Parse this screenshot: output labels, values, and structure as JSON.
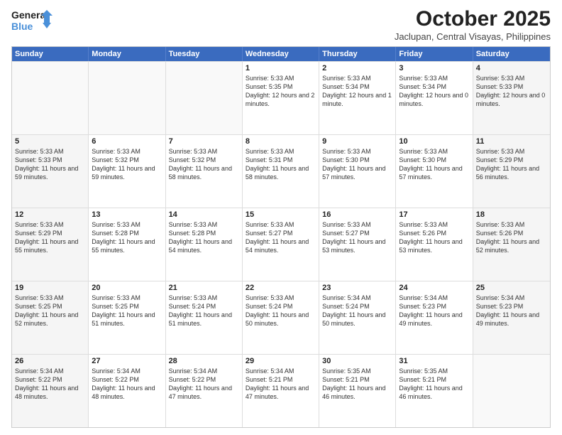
{
  "logo": {
    "line1": "General",
    "line2": "Blue"
  },
  "title": "October 2025",
  "subtitle": "Jaclupan, Central Visayas, Philippines",
  "header": {
    "days": [
      "Sunday",
      "Monday",
      "Tuesday",
      "Wednesday",
      "Thursday",
      "Friday",
      "Saturday"
    ]
  },
  "weeks": [
    [
      {
        "day": "",
        "sunrise": "",
        "sunset": "",
        "daylight": ""
      },
      {
        "day": "",
        "sunrise": "",
        "sunset": "",
        "daylight": ""
      },
      {
        "day": "",
        "sunrise": "",
        "sunset": "",
        "daylight": ""
      },
      {
        "day": "1",
        "sunrise": "Sunrise: 5:33 AM",
        "sunset": "Sunset: 5:35 PM",
        "daylight": "Daylight: 12 hours and 2 minutes."
      },
      {
        "day": "2",
        "sunrise": "Sunrise: 5:33 AM",
        "sunset": "Sunset: 5:34 PM",
        "daylight": "Daylight: 12 hours and 1 minute."
      },
      {
        "day": "3",
        "sunrise": "Sunrise: 5:33 AM",
        "sunset": "Sunset: 5:34 PM",
        "daylight": "Daylight: 12 hours and 0 minutes."
      },
      {
        "day": "4",
        "sunrise": "Sunrise: 5:33 AM",
        "sunset": "Sunset: 5:33 PM",
        "daylight": "Daylight: 12 hours and 0 minutes."
      }
    ],
    [
      {
        "day": "5",
        "sunrise": "Sunrise: 5:33 AM",
        "sunset": "Sunset: 5:33 PM",
        "daylight": "Daylight: 11 hours and 59 minutes."
      },
      {
        "day": "6",
        "sunrise": "Sunrise: 5:33 AM",
        "sunset": "Sunset: 5:32 PM",
        "daylight": "Daylight: 11 hours and 59 minutes."
      },
      {
        "day": "7",
        "sunrise": "Sunrise: 5:33 AM",
        "sunset": "Sunset: 5:32 PM",
        "daylight": "Daylight: 11 hours and 58 minutes."
      },
      {
        "day": "8",
        "sunrise": "Sunrise: 5:33 AM",
        "sunset": "Sunset: 5:31 PM",
        "daylight": "Daylight: 11 hours and 58 minutes."
      },
      {
        "day": "9",
        "sunrise": "Sunrise: 5:33 AM",
        "sunset": "Sunset: 5:30 PM",
        "daylight": "Daylight: 11 hours and 57 minutes."
      },
      {
        "day": "10",
        "sunrise": "Sunrise: 5:33 AM",
        "sunset": "Sunset: 5:30 PM",
        "daylight": "Daylight: 11 hours and 57 minutes."
      },
      {
        "day": "11",
        "sunrise": "Sunrise: 5:33 AM",
        "sunset": "Sunset: 5:29 PM",
        "daylight": "Daylight: 11 hours and 56 minutes."
      }
    ],
    [
      {
        "day": "12",
        "sunrise": "Sunrise: 5:33 AM",
        "sunset": "Sunset: 5:29 PM",
        "daylight": "Daylight: 11 hours and 55 minutes."
      },
      {
        "day": "13",
        "sunrise": "Sunrise: 5:33 AM",
        "sunset": "Sunset: 5:28 PM",
        "daylight": "Daylight: 11 hours and 55 minutes."
      },
      {
        "day": "14",
        "sunrise": "Sunrise: 5:33 AM",
        "sunset": "Sunset: 5:28 PM",
        "daylight": "Daylight: 11 hours and 54 minutes."
      },
      {
        "day": "15",
        "sunrise": "Sunrise: 5:33 AM",
        "sunset": "Sunset: 5:27 PM",
        "daylight": "Daylight: 11 hours and 54 minutes."
      },
      {
        "day": "16",
        "sunrise": "Sunrise: 5:33 AM",
        "sunset": "Sunset: 5:27 PM",
        "daylight": "Daylight: 11 hours and 53 minutes."
      },
      {
        "day": "17",
        "sunrise": "Sunrise: 5:33 AM",
        "sunset": "Sunset: 5:26 PM",
        "daylight": "Daylight: 11 hours and 53 minutes."
      },
      {
        "day": "18",
        "sunrise": "Sunrise: 5:33 AM",
        "sunset": "Sunset: 5:26 PM",
        "daylight": "Daylight: 11 hours and 52 minutes."
      }
    ],
    [
      {
        "day": "19",
        "sunrise": "Sunrise: 5:33 AM",
        "sunset": "Sunset: 5:25 PM",
        "daylight": "Daylight: 11 hours and 52 minutes."
      },
      {
        "day": "20",
        "sunrise": "Sunrise: 5:33 AM",
        "sunset": "Sunset: 5:25 PM",
        "daylight": "Daylight: 11 hours and 51 minutes."
      },
      {
        "day": "21",
        "sunrise": "Sunrise: 5:33 AM",
        "sunset": "Sunset: 5:24 PM",
        "daylight": "Daylight: 11 hours and 51 minutes."
      },
      {
        "day": "22",
        "sunrise": "Sunrise: 5:33 AM",
        "sunset": "Sunset: 5:24 PM",
        "daylight": "Daylight: 11 hours and 50 minutes."
      },
      {
        "day": "23",
        "sunrise": "Sunrise: 5:34 AM",
        "sunset": "Sunset: 5:24 PM",
        "daylight": "Daylight: 11 hours and 50 minutes."
      },
      {
        "day": "24",
        "sunrise": "Sunrise: 5:34 AM",
        "sunset": "Sunset: 5:23 PM",
        "daylight": "Daylight: 11 hours and 49 minutes."
      },
      {
        "day": "25",
        "sunrise": "Sunrise: 5:34 AM",
        "sunset": "Sunset: 5:23 PM",
        "daylight": "Daylight: 11 hours and 49 minutes."
      }
    ],
    [
      {
        "day": "26",
        "sunrise": "Sunrise: 5:34 AM",
        "sunset": "Sunset: 5:22 PM",
        "daylight": "Daylight: 11 hours and 48 minutes."
      },
      {
        "day": "27",
        "sunrise": "Sunrise: 5:34 AM",
        "sunset": "Sunset: 5:22 PM",
        "daylight": "Daylight: 11 hours and 48 minutes."
      },
      {
        "day": "28",
        "sunrise": "Sunrise: 5:34 AM",
        "sunset": "Sunset: 5:22 PM",
        "daylight": "Daylight: 11 hours and 47 minutes."
      },
      {
        "day": "29",
        "sunrise": "Sunrise: 5:34 AM",
        "sunset": "Sunset: 5:21 PM",
        "daylight": "Daylight: 11 hours and 47 minutes."
      },
      {
        "day": "30",
        "sunrise": "Sunrise: 5:35 AM",
        "sunset": "Sunset: 5:21 PM",
        "daylight": "Daylight: 11 hours and 46 minutes."
      },
      {
        "day": "31",
        "sunrise": "Sunrise: 5:35 AM",
        "sunset": "Sunset: 5:21 PM",
        "daylight": "Daylight: 11 hours and 46 minutes."
      },
      {
        "day": "",
        "sunrise": "",
        "sunset": "",
        "daylight": ""
      }
    ]
  ]
}
